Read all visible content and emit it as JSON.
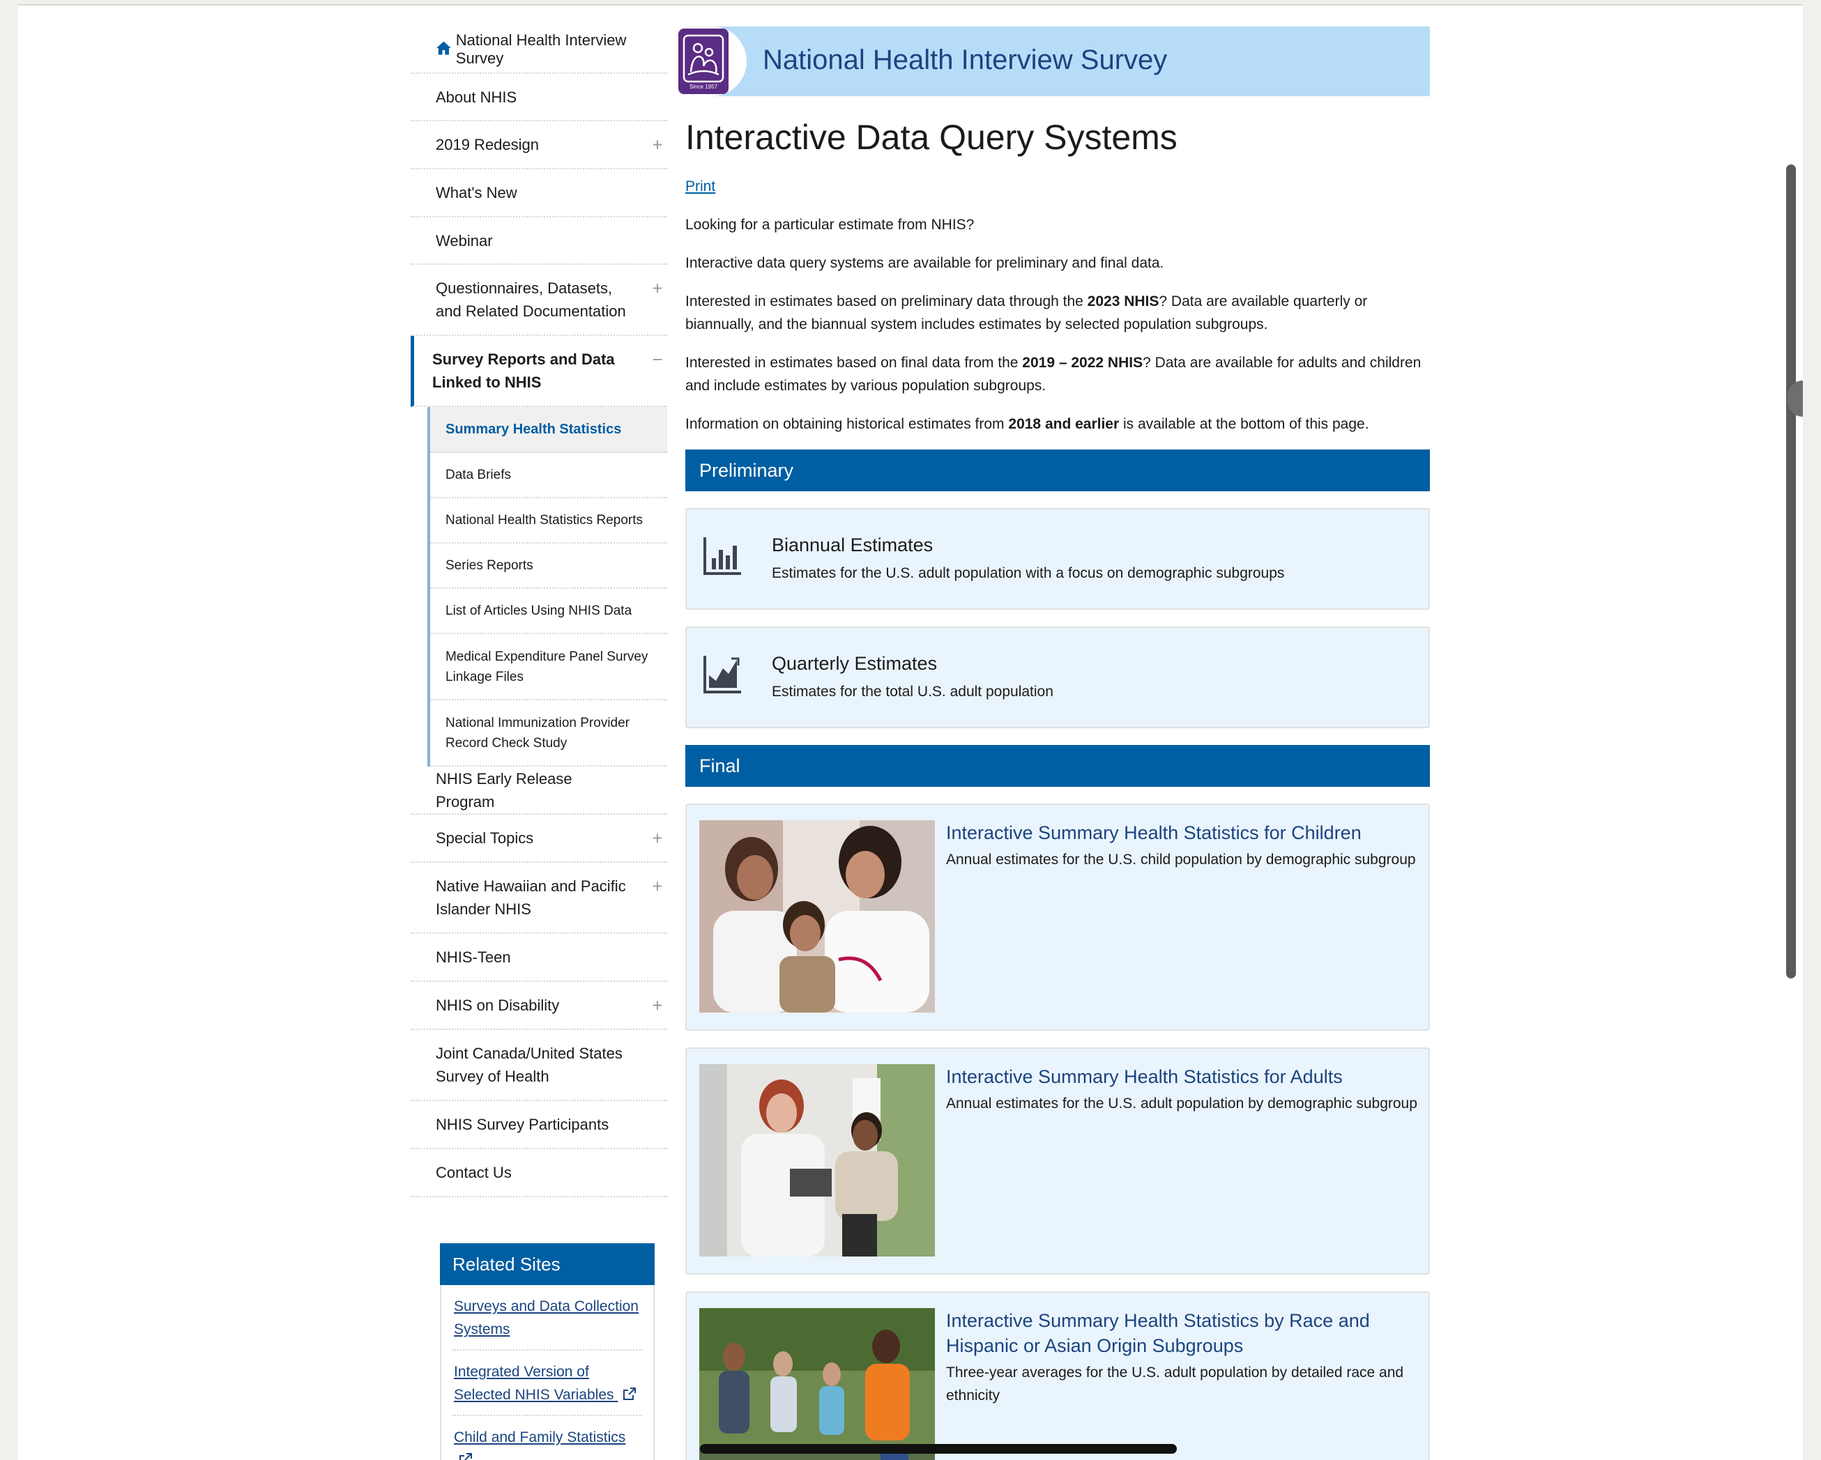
{
  "sidebar": {
    "home_label": "National Health Interview Survey",
    "items": [
      {
        "label": "About NHIS",
        "expand": ""
      },
      {
        "label": "2019 Redesign",
        "expand": "+"
      },
      {
        "label": "What's New",
        "expand": ""
      },
      {
        "label": "Webinar",
        "expand": ""
      },
      {
        "label": "Questionnaires, Datasets, and Related Documentation",
        "expand": "+"
      },
      {
        "label": "Survey Reports and Data Linked to NHIS",
        "expand": "−"
      }
    ],
    "subitems": [
      "Summary Health Statistics",
      "Data Briefs",
      "National Health Statistics Reports",
      "Series Reports",
      "List of Articles Using NHIS Data",
      "Medical Expenditure Panel Survey Linkage Files",
      "National Immunization Provider Record Check Study"
    ],
    "items_after": [
      {
        "label": "NHIS Early Release Program",
        "expand": ""
      },
      {
        "label": "Special Topics",
        "expand": "+"
      },
      {
        "label": "Native Hawaiian and Pacific Islander NHIS",
        "expand": "+"
      },
      {
        "label": "NHIS-Teen",
        "expand": ""
      },
      {
        "label": "NHIS on Disability",
        "expand": "+"
      },
      {
        "label": "Joint Canada/United States Survey of Health",
        "expand": ""
      },
      {
        "label": "NHIS Survey Participants",
        "expand": ""
      },
      {
        "label": "Contact Us",
        "expand": ""
      }
    ]
  },
  "related": {
    "heading": "Related Sites",
    "links": [
      "Surveys and Data Collection Systems",
      "Integrated Version of Selected NHIS Variables",
      "Child and Family Statistics"
    ]
  },
  "banner": {
    "title": "National Health Interview Survey",
    "logo_text": "Since 1957"
  },
  "main": {
    "title": "Interactive Data Query Systems",
    "print_label": "Print",
    "p1": "Looking for a particular estimate from NHIS?",
    "p2": "Interactive data query systems are available for preliminary and final data.",
    "p3_a": "Interested in estimates based on preliminary data through the ",
    "p3_b": "2023 NHIS",
    "p3_c": "? Data are available quarterly or biannually, and the biannual system includes estimates by selected population subgroups.",
    "p4_a": "Interested in estimates based on final data from the ",
    "p4_b": "2019 – 2022 NHIS",
    "p4_c": "? Data are available for adults and children and include estimates by various population subgroups.",
    "p5_a": "Information on obtaining historical estimates from ",
    "p5_b": "2018 and earlier",
    "p5_c": " is available at the bottom of this page."
  },
  "preliminary": {
    "heading": "Preliminary",
    "cards": [
      {
        "title": "Biannual Estimates",
        "desc": "Estimates for the U.S. adult population with a focus on demographic subgroups",
        "icon": "bar-chart-icon"
      },
      {
        "title": "Quarterly Estimates",
        "desc": "Estimates for the total U.S. adult population",
        "icon": "trend-chart-icon"
      }
    ]
  },
  "final": {
    "heading": "Final",
    "cards": [
      {
        "title": "Interactive Summary Health Statistics for Children",
        "desc": "Annual estimates for the U.S. child population by demographic subgroup"
      },
      {
        "title": "Interactive Summary Health Statistics for Adults",
        "desc": "Annual estimates for the U.S. adult population by demographic subgroup"
      },
      {
        "title": "Interactive Summary Health Statistics by Race and Hispanic or Asian Origin Subgroups",
        "desc": "Three-year averages for the U.S. adult population by detailed race and ethnicity"
      }
    ]
  },
  "colors": {
    "accent": "#005ea2",
    "link": "#1a4480",
    "banner_bg": "#b6dcf8",
    "card_bg": "#eaf4fc",
    "logo": "#5b2c83"
  }
}
